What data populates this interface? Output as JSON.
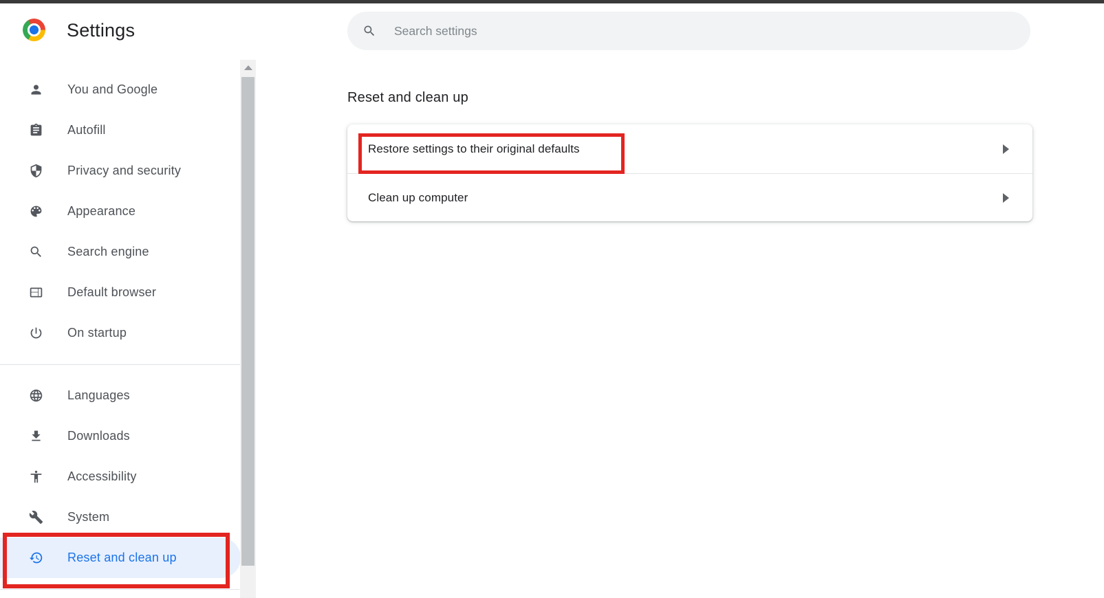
{
  "app": {
    "title": "Settings"
  },
  "search": {
    "placeholder": "Search settings",
    "icon": "search-icon"
  },
  "sidebar": {
    "items": [
      {
        "label": "You and Google",
        "icon": "person-icon",
        "selected": false
      },
      {
        "label": "Autofill",
        "icon": "autofill-clipboard-icon",
        "selected": false
      },
      {
        "label": "Privacy and security",
        "icon": "shield-icon",
        "selected": false
      },
      {
        "label": "Appearance",
        "icon": "palette-icon",
        "selected": false
      },
      {
        "label": "Search engine",
        "icon": "magnifier-icon",
        "selected": false
      },
      {
        "label": "Default browser",
        "icon": "browser-window-icon",
        "selected": false
      },
      {
        "label": "On startup",
        "icon": "power-icon",
        "selected": false
      },
      {
        "label": "Languages",
        "icon": "globe-icon",
        "selected": false
      },
      {
        "label": "Downloads",
        "icon": "download-icon",
        "selected": false
      },
      {
        "label": "Accessibility",
        "icon": "accessibility-icon",
        "selected": false
      },
      {
        "label": "System",
        "icon": "wrench-icon",
        "selected": false
      },
      {
        "label": "Reset and clean up",
        "icon": "restore-clock-icon",
        "selected": true
      }
    ]
  },
  "main": {
    "section_title": "Reset and clean up",
    "rows": [
      {
        "label": "Restore settings to their original defaults",
        "annotated": true
      },
      {
        "label": "Clean up computer",
        "annotated": false
      }
    ]
  },
  "annotations": [
    {
      "target": "restore-settings-row-label"
    },
    {
      "target": "sidebar-item-reset-and-clean-up"
    }
  ],
  "colors": {
    "accent_blue": "#1a73e8",
    "selected_item_bg": "#e8f0fe",
    "annotation_red": "#e32521",
    "icon_gray": "#54585e",
    "text_dark": "#202124",
    "search_bg": "#f1f3f4"
  }
}
